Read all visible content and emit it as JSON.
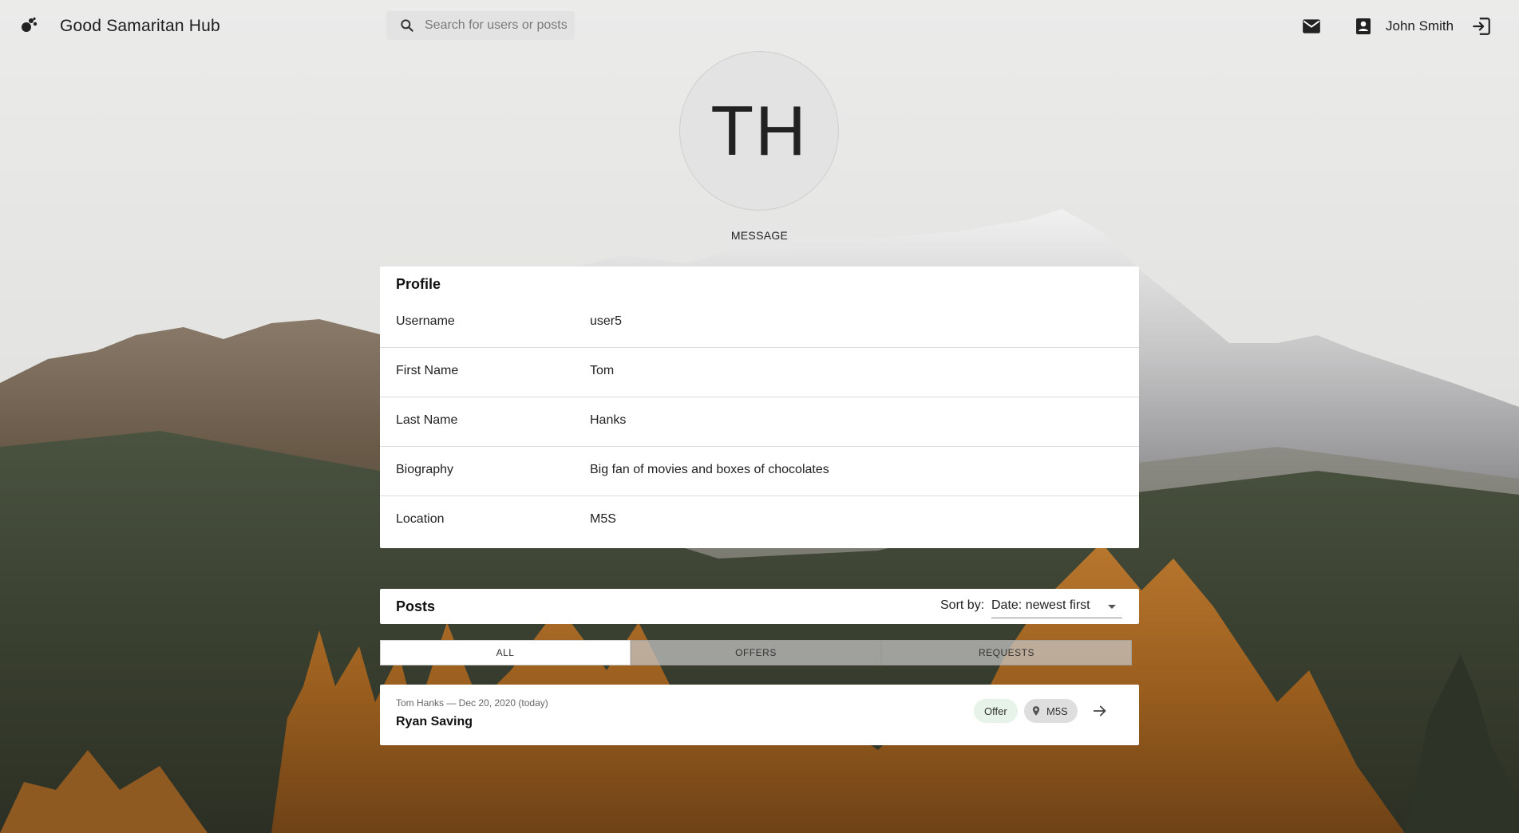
{
  "header": {
    "app_title": "Good Samaritan Hub",
    "search_placeholder": "Search for users or posts",
    "user_name": "John Smith",
    "icons": [
      "logo-icon",
      "search-icon",
      "mail-icon",
      "account-box-icon",
      "logout-icon"
    ]
  },
  "profile_header": {
    "avatar_initials": "TH",
    "message_button": "MESSAGE"
  },
  "profile": {
    "title": "Profile",
    "rows": [
      {
        "label": "Username",
        "value": "user5"
      },
      {
        "label": "First Name",
        "value": "Tom"
      },
      {
        "label": "Last Name",
        "value": "Hanks"
      },
      {
        "label": "Biography",
        "value": "Big fan of movies and boxes of chocolates"
      },
      {
        "label": "Location",
        "value": "M5S"
      }
    ]
  },
  "posts": {
    "title": "Posts",
    "sort_label": "Sort by:",
    "sort_value": "Date: newest first",
    "tabs": [
      {
        "label": "ALL",
        "active": true
      },
      {
        "label": "OFFERS",
        "active": false
      },
      {
        "label": "REQUESTS",
        "active": false
      }
    ],
    "items": [
      {
        "meta": "Tom Hanks — Dec 20, 2020 (today)",
        "title": "Ryan Saving",
        "type_chip": "Offer",
        "location_chip": "M5S"
      }
    ]
  },
  "colors": {
    "card_bg": "#ffffff",
    "offer_chip_bg": "#e7f3e9",
    "location_chip_bg": "#dedede",
    "tab_inactive_bg": "#c8c8c8"
  }
}
